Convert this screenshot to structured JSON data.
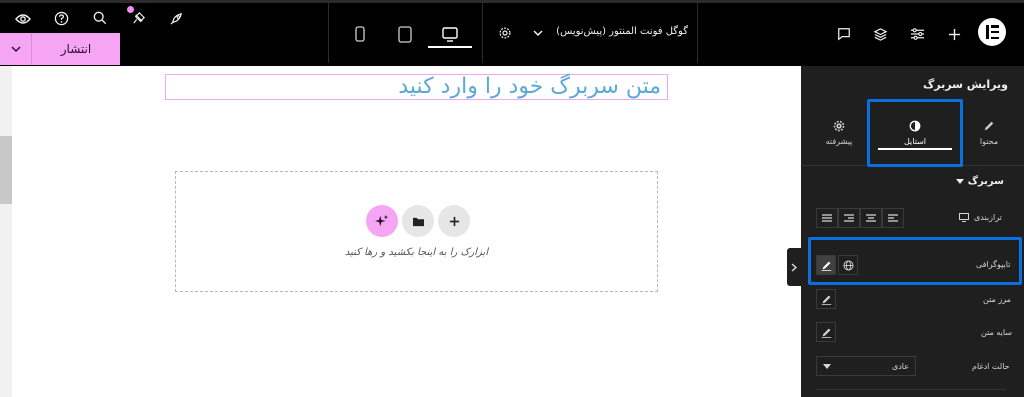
{
  "topbar": {
    "publish_label": "انتشار",
    "document_title": "گوگل فونت المنتور (پیش‌نویس)",
    "left_icons": [
      "eye-icon",
      "help-icon",
      "search-icon",
      "notes-icon",
      "rocket-icon"
    ],
    "device_icons": [
      "mobile-icon",
      "tablet-icon",
      "desktop-icon"
    ],
    "active_device": "desktop",
    "right_icons": [
      "comment-icon",
      "layers-icon",
      "settings-sliders-icon",
      "plus-icon"
    ],
    "logo": "elementor-logo"
  },
  "canvas": {
    "heading_text": "متن سربرگ خود را وارد کنید",
    "drop_hint": "ابزارک را به اینجا بکشید و رها کنید",
    "drop_buttons": [
      "ai-sparkle-icon",
      "folder-icon",
      "plus-icon"
    ]
  },
  "panel": {
    "title": "ویرایش سربرگ",
    "tabs": [
      {
        "label": "محتوا",
        "icon": "pencil-icon"
      },
      {
        "label": "استایل",
        "icon": "contrast-icon"
      },
      {
        "label": "پیشرفته",
        "icon": "gear-icon"
      }
    ],
    "active_tab": "استایل",
    "section_title": "سربرگ",
    "rows": {
      "alignment": "ترازبندی",
      "typography": "تایپوگرافی",
      "text_stroke": "مرز متن",
      "text_shadow": "سایه متن",
      "blend_mode": "حالت ادغام"
    },
    "blend_mode_value": "عادی"
  },
  "colors": {
    "accent_pink": "#f6a5f4",
    "highlight_blue": "#0b6fe0",
    "heading_blue": "#5aa9d8",
    "panel_bg": "#1f1f1f"
  }
}
